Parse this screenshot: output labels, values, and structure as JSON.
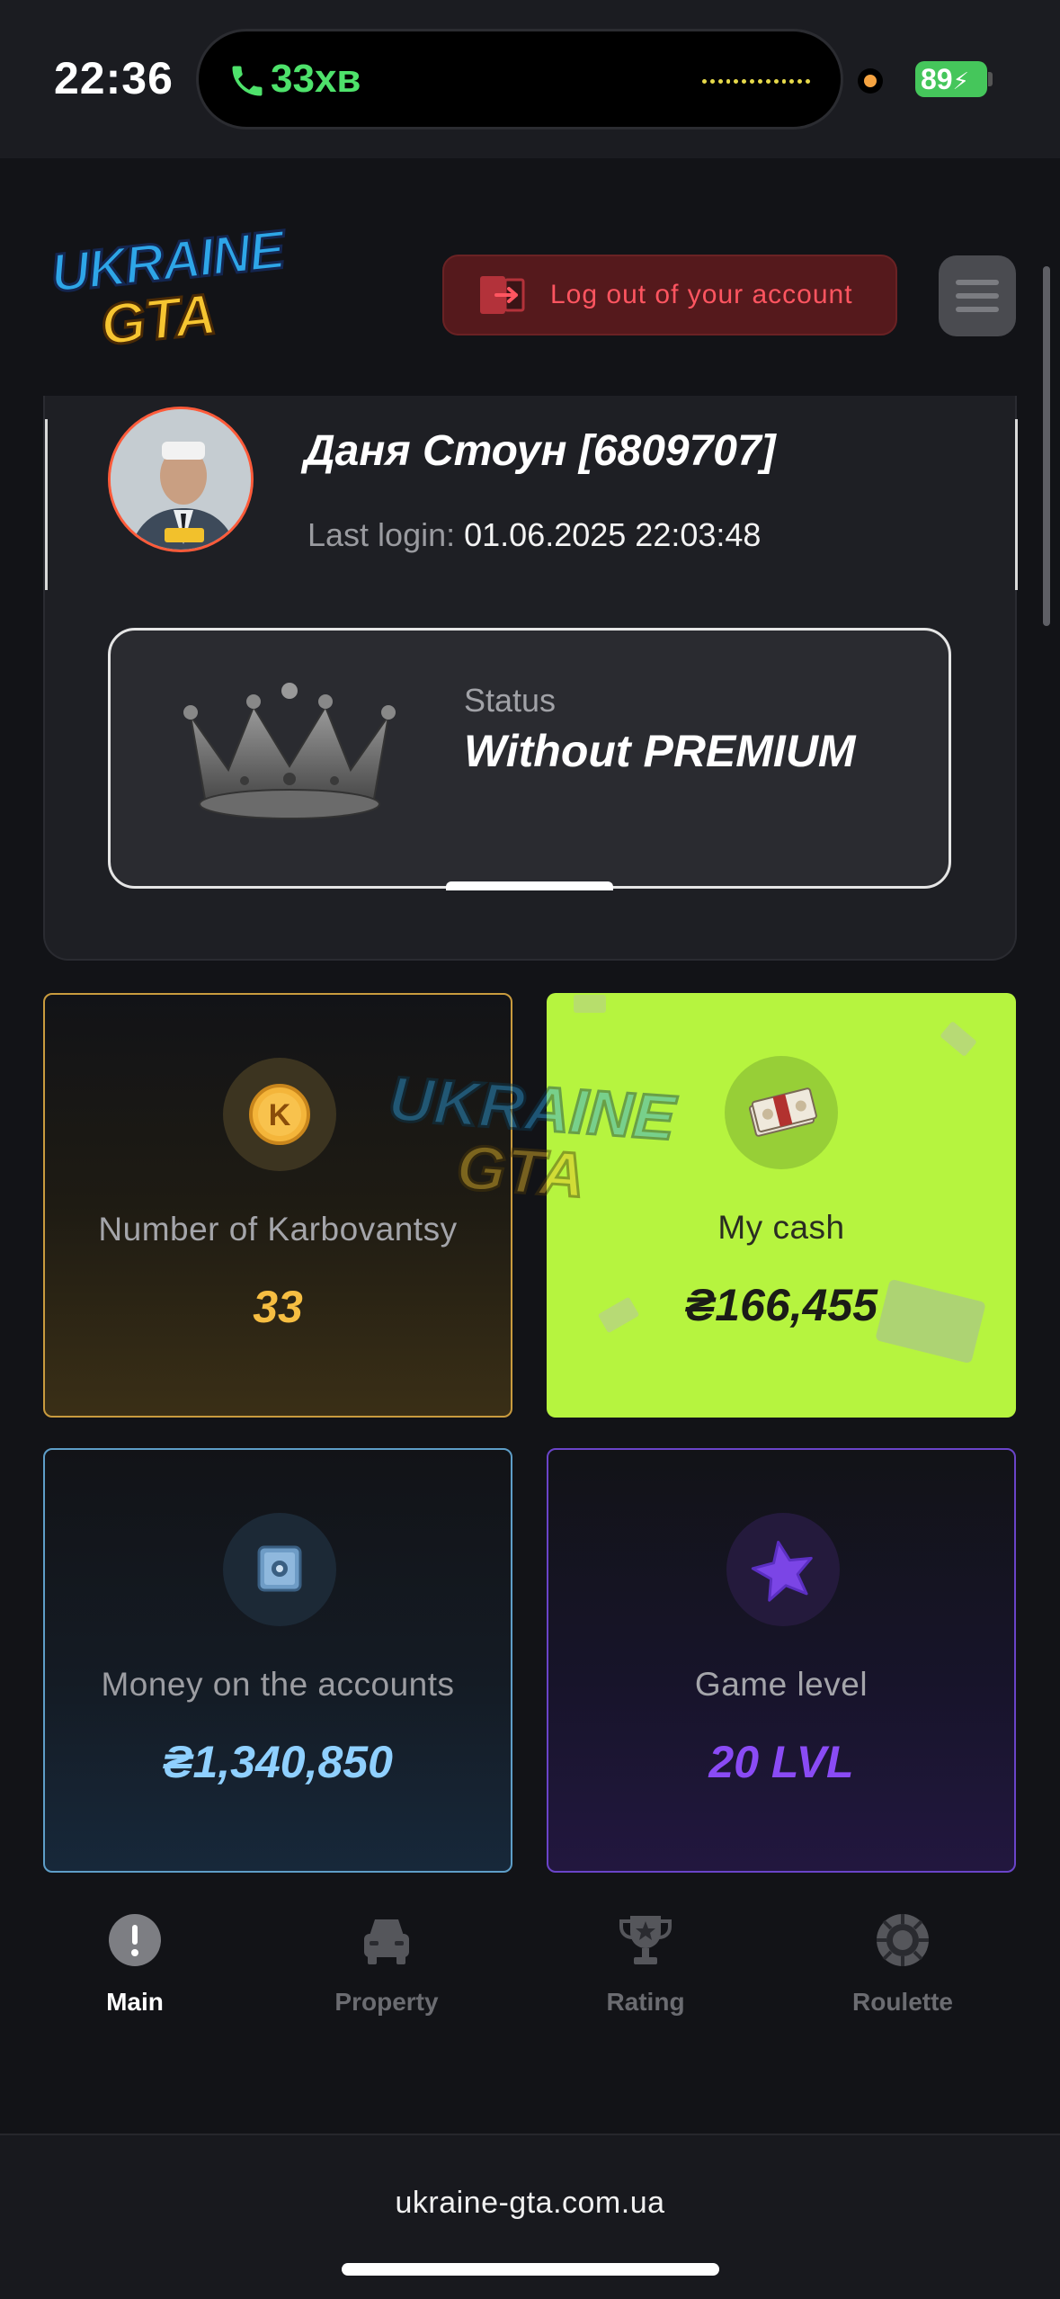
{
  "status_bar": {
    "time": "22:36",
    "call_duration": "33хв",
    "battery": "89"
  },
  "header": {
    "logo_line1": "UKRAINE",
    "logo_line2": "GTA",
    "logout_label": "Log out of your account"
  },
  "profile": {
    "name": "Даня Стоун [6809707]",
    "last_login_label": "Last login:",
    "last_login_value": "01.06.2025 22:03:48",
    "status_label": "Status",
    "status_value": "Without PREMIUM"
  },
  "stats": {
    "karbovantsy": {
      "label": "Number of Karbovantsy",
      "value": "33"
    },
    "cash": {
      "label": "My cash",
      "value": "₴166,455"
    },
    "accounts": {
      "label": "Money on the accounts",
      "value": "₴1,340,850"
    },
    "level": {
      "label": "Game level",
      "value": "20 LVL"
    }
  },
  "watermark": {
    "line1": "UKRAINE",
    "line2": "GTA"
  },
  "nav": {
    "items": [
      {
        "label": "Main",
        "icon": "exclamation-icon",
        "active": true
      },
      {
        "label": "Property",
        "icon": "car-icon",
        "active": false
      },
      {
        "label": "Rating",
        "icon": "trophy-icon",
        "active": false
      },
      {
        "label": "Roulette",
        "icon": "roulette-icon",
        "active": false
      }
    ]
  },
  "footer": {
    "url": "ukraine-gta.com.ua"
  },
  "colors": {
    "gold": "#f6be42",
    "lime": "#b6f43f",
    "blue": "#8fd0ff",
    "purple": "#8a4bf5",
    "danger": "#ff5560"
  }
}
